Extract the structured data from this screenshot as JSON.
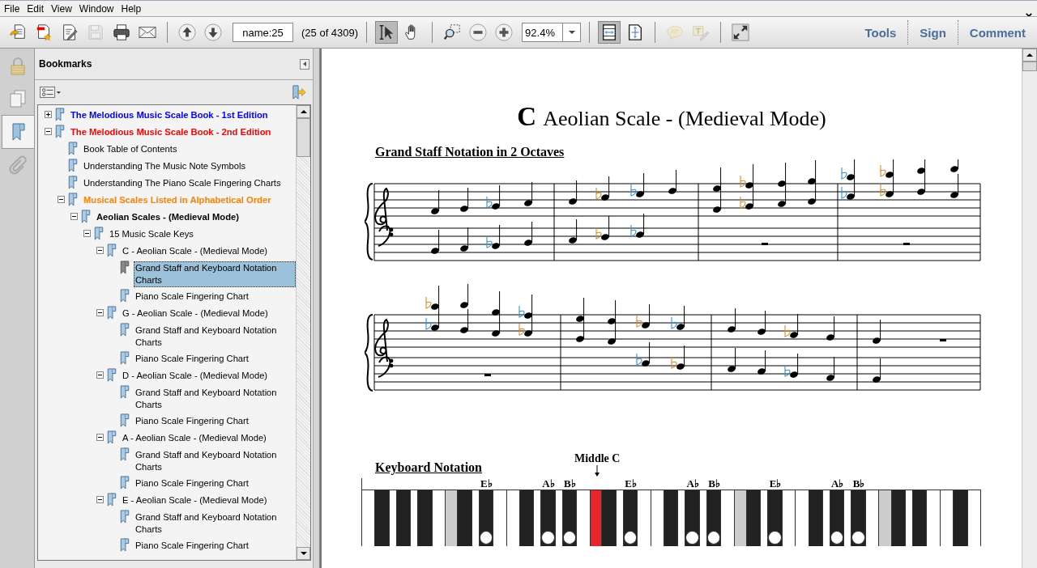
{
  "menu": [
    "File",
    "Edit",
    "View",
    "Window",
    "Help"
  ],
  "toolbar": {
    "file_tools": [
      {
        "kind": "open",
        "selected": false,
        "disabled": false
      },
      {
        "kind": "create",
        "selected": false,
        "disabled": false
      },
      {
        "kind": "edit",
        "selected": false,
        "disabled": false
      },
      {
        "kind": "save",
        "selected": false,
        "disabled": true
      },
      {
        "kind": "print",
        "selected": false,
        "disabled": false
      },
      {
        "kind": "email",
        "selected": false,
        "disabled": false
      }
    ],
    "nav_tools": [
      {
        "kind": "prev",
        "selected": false,
        "disabled": false
      },
      {
        "kind": "next",
        "selected": false,
        "disabled": false
      }
    ],
    "page_field": {
      "value": "name:25"
    },
    "page_count": "(25 of 4309)",
    "select_tools": [
      {
        "kind": "select",
        "selected": true,
        "disabled": false
      },
      {
        "kind": "hand",
        "selected": false,
        "disabled": false
      }
    ],
    "zoom_tools": [
      {
        "kind": "marquee",
        "selected": false,
        "disabled": false
      },
      {
        "kind": "zoomout",
        "selected": false,
        "disabled": false
      },
      {
        "kind": "zoomin",
        "selected": false,
        "disabled": false
      }
    ],
    "zoom_field": {
      "value": "92.4%"
    },
    "view_tools": [
      {
        "kind": "fitpage",
        "selected": true,
        "disabled": false
      },
      {
        "kind": "fitwidth",
        "selected": false,
        "disabled": false
      }
    ],
    "comment_tools": [
      {
        "kind": "note",
        "selected": false,
        "disabled": true
      },
      {
        "kind": "markup",
        "selected": false,
        "disabled": true
      }
    ],
    "extra_tools": [
      {
        "kind": "fullscreen",
        "selected": false,
        "disabled": false
      }
    ],
    "links": [
      "Tools",
      "Sign",
      "Comment"
    ]
  },
  "rail": [
    {
      "kind": "lock",
      "selected": false
    },
    {
      "kind": "pages",
      "selected": false
    },
    {
      "kind": "bookmarks",
      "selected": true
    },
    {
      "kind": "attachments",
      "selected": false
    }
  ],
  "bookmarks": {
    "title": "Bookmarks",
    "items": [
      {
        "label": "The Melodious Music Scale Book - 1st Edition",
        "color": "#0000ff",
        "bold": true,
        "expanded": false,
        "selected": false
      },
      {
        "label": "The Melodious Music Scale Book - 2nd Edition",
        "color": "#ff0000",
        "bold": true,
        "expanded": true,
        "selected": false,
        "children": [
          {
            "label": "Book Table of Contents",
            "bold": false,
            "selected": false
          },
          {
            "label": "Understanding The Music Note Symbols",
            "bold": false,
            "selected": false
          },
          {
            "label": "Understanding The Piano Scale Fingering Charts",
            "bold": false,
            "selected": false
          },
          {
            "label": "Musical Scales Listed in Alphabetical Order",
            "color": "#ff8000",
            "bold": true,
            "expanded": true,
            "selected": false,
            "children": [
              {
                "label": "Aeolian Scales - (Medieval Mode)",
                "bold": true,
                "expanded": true,
                "selected": false,
                "children": [
                  {
                    "label": "15 Music Scale Keys",
                    "bold": false,
                    "expanded": true,
                    "selected": false,
                    "children": [
                      {
                        "label": "C - Aeolian Scale - (Medieval Mode)",
                        "bold": false,
                        "expanded": true,
                        "selected": false,
                        "children": [
                          {
                            "label": "Grand Staff and Keyboard Notation Charts",
                            "bold": false,
                            "selected": true
                          },
                          {
                            "label": "Piano Scale Fingering Chart",
                            "bold": false,
                            "selected": false
                          }
                        ]
                      },
                      {
                        "label": "G - Aeolian Scale - (Medieval Mode)",
                        "bold": false,
                        "expanded": true,
                        "selected": false,
                        "children": [
                          {
                            "label": "Grand Staff and Keyboard Notation Charts",
                            "bold": false,
                            "selected": false
                          },
                          {
                            "label": "Piano Scale Fingering Chart",
                            "bold": false,
                            "selected": false
                          }
                        ]
                      },
                      {
                        "label": "D - Aeolian Scale - (Medieval Mode)",
                        "bold": false,
                        "expanded": true,
                        "selected": false,
                        "children": [
                          {
                            "label": "Grand Staff and Keyboard Notation Charts",
                            "bold": false,
                            "selected": false
                          },
                          {
                            "label": "Piano Scale Fingering Chart",
                            "bold": false,
                            "selected": false
                          }
                        ]
                      },
                      {
                        "label": "A - Aeolian Scale - (Medieval Mode)",
                        "bold": false,
                        "expanded": true,
                        "selected": false,
                        "children": [
                          {
                            "label": "Grand Staff and Keyboard Notation Charts",
                            "bold": false,
                            "selected": false
                          },
                          {
                            "label": "Piano Scale Fingering Chart",
                            "bold": false,
                            "selected": false
                          }
                        ]
                      },
                      {
                        "label": "E - Aeolian Scale - (Medieval Mode)",
                        "bold": false,
                        "expanded": true,
                        "selected": false,
                        "children": [
                          {
                            "label": "Grand Staff and Keyboard Notation Charts",
                            "bold": false,
                            "selected": false
                          },
                          {
                            "label": "Piano Scale Fingering Chart",
                            "bold": false,
                            "selected": false
                          }
                        ]
                      }
                    ]
                  }
                ]
              }
            ]
          }
        ]
      }
    ]
  },
  "document": {
    "title_key": "C",
    "title": "Aeolian Scale - (Medieval Mode)",
    "staff_heading": "Grand Staff Notation in 2 Octaves",
    "keyboard_heading": "Keyboard Notation",
    "middle_c": "Middle C",
    "keys": [
      {
        "kind": "white",
        "marked": false
      },
      {
        "kind": "black",
        "marked": false
      },
      {
        "kind": "narrow",
        "marked": false
      },
      {
        "kind": "black",
        "marked": false
      },
      {
        "kind": "narrow",
        "marked": false
      },
      {
        "kind": "black",
        "marked": false
      },
      {
        "kind": "white",
        "marked": false
      },
      {
        "kind": "grey",
        "marked": false
      },
      {
        "kind": "black",
        "marked": false
      },
      {
        "kind": "narrow",
        "marked": false
      },
      {
        "kind": "black",
        "marked": true,
        "label": "E♭"
      },
      {
        "kind": "white",
        "marked": false
      },
      {
        "kind": "white",
        "marked": false
      },
      {
        "kind": "black",
        "marked": false
      },
      {
        "kind": "narrow",
        "marked": false
      },
      {
        "kind": "black",
        "marked": true,
        "label": "A♭"
      },
      {
        "kind": "narrow",
        "marked": false
      },
      {
        "kind": "black",
        "marked": true,
        "label": "B♭"
      },
      {
        "kind": "white",
        "marked": false
      },
      {
        "kind": "red",
        "marked": false
      },
      {
        "kind": "black",
        "marked": false
      },
      {
        "kind": "narrow",
        "marked": false
      },
      {
        "kind": "black",
        "marked": true,
        "label": "E♭"
      },
      {
        "kind": "white",
        "marked": false
      },
      {
        "kind": "white",
        "marked": false
      },
      {
        "kind": "black",
        "marked": false
      },
      {
        "kind": "narrow",
        "marked": false
      },
      {
        "kind": "black",
        "marked": true,
        "label": "A♭"
      },
      {
        "kind": "narrow",
        "marked": false
      },
      {
        "kind": "black",
        "marked": true,
        "label": "B♭"
      },
      {
        "kind": "white",
        "marked": false
      },
      {
        "kind": "grey",
        "marked": false
      },
      {
        "kind": "black",
        "marked": false
      },
      {
        "kind": "narrow",
        "marked": false
      },
      {
        "kind": "black",
        "marked": true,
        "label": "E♭"
      },
      {
        "kind": "white",
        "marked": false
      },
      {
        "kind": "white",
        "marked": false
      },
      {
        "kind": "black",
        "marked": false
      },
      {
        "kind": "narrow",
        "marked": false
      },
      {
        "kind": "black",
        "marked": true,
        "label": "A♭"
      },
      {
        "kind": "narrow",
        "marked": false
      },
      {
        "kind": "black",
        "marked": true,
        "label": "B♭"
      },
      {
        "kind": "white",
        "marked": false
      },
      {
        "kind": "grey",
        "marked": false
      },
      {
        "kind": "black",
        "marked": false
      },
      {
        "kind": "narrow",
        "marked": false
      },
      {
        "kind": "black",
        "marked": false
      },
      {
        "kind": "white",
        "marked": false
      },
      {
        "kind": "white",
        "marked": false
      },
      {
        "kind": "black",
        "marked": false
      },
      {
        "kind": "white",
        "marked": false
      }
    ]
  }
}
